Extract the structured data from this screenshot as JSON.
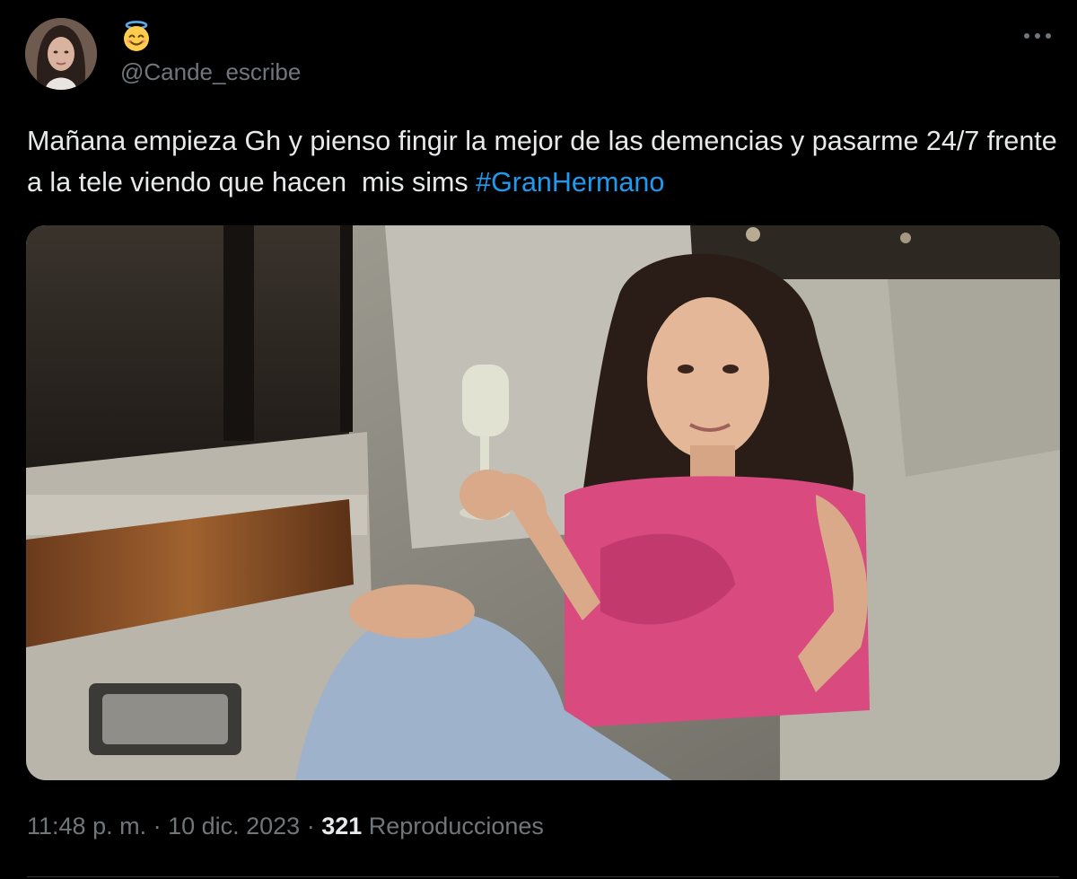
{
  "tweet": {
    "author": {
      "display_name_emoji": "smiling-face-with-halo",
      "handle": "@Cande_escribe"
    },
    "text": "Mañana empieza Gh y pienso fingir la mejor de las demencias y pasarme 24/7 frente a la tele viendo que hacen  mis sims ",
    "hashtag": "#GranHermano",
    "time": "11:48 p. m.",
    "separator": " · ",
    "date": "10 dic. 2023",
    "views_count": "321",
    "views_label": " Reproducciones"
  },
  "icons": {
    "more": "more-horizontal-icon",
    "emoji": "smiling-face-with-halo-icon"
  },
  "colors": {
    "background": "#000000",
    "text": "#e7e9ea",
    "secondary": "#71767b",
    "hashtag": "#1d9bf0"
  }
}
